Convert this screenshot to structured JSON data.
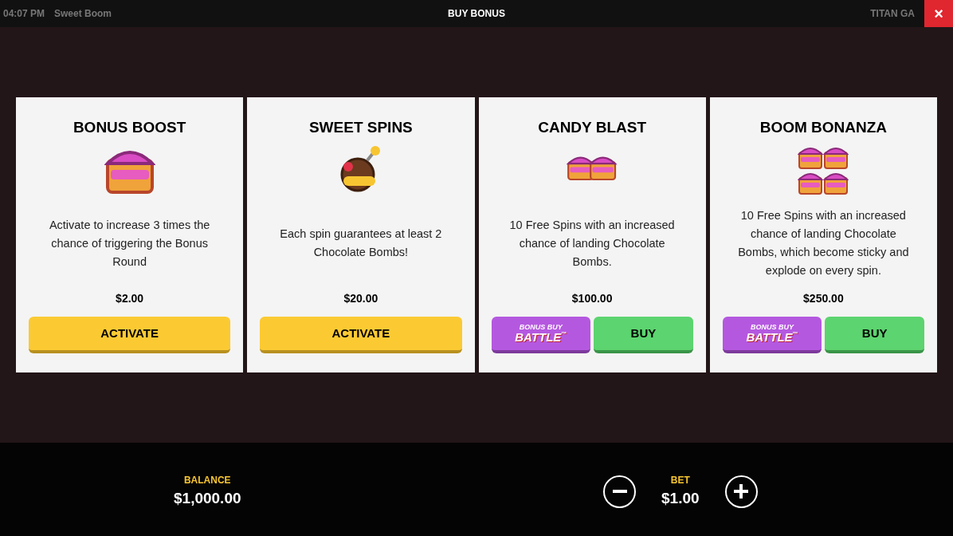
{
  "top_bar": {
    "time": "04:07 PM",
    "game": "Sweet Boom",
    "title": "BUY BONUS",
    "provider": "TITAN GA",
    "close": "×"
  },
  "cards": [
    {
      "title": "BONUS BOOST",
      "kind": "chest",
      "description": "Activate to increase 3 times the chance of triggering the Bonus Round",
      "price": "$2.00",
      "buttons": [
        {
          "kind": "activate",
          "label": "ACTIVATE"
        }
      ]
    },
    {
      "title": "SWEET SPINS",
      "kind": "bomb",
      "description": "Each spin guarantees at least 2 Chocolate Bombs!",
      "price": "$20.00",
      "buttons": [
        {
          "kind": "activate",
          "label": "ACTIVATE"
        }
      ]
    },
    {
      "title": "CANDY BLAST",
      "kind": "two_chests",
      "description": "10 Free Spins with an increased chance of landing Chocolate Bombs.",
      "price": "$100.00",
      "buttons": [
        {
          "kind": "battle",
          "label": "BONUS BUY",
          "label2": "BATTLE",
          "mark": "™"
        },
        {
          "kind": "buy",
          "label": "BUY"
        }
      ]
    },
    {
      "title": "BOOM BONANZA",
      "kind": "four_chests",
      "description": "10 Free Spins with an increased chance of landing Chocolate Bombs, which become sticky and explode on every spin.",
      "price": "$250.00",
      "buttons": [
        {
          "kind": "battle",
          "label": "BONUS BUY",
          "label2": "BATTLE",
          "mark": "™"
        },
        {
          "kind": "buy",
          "label": "BUY"
        }
      ]
    }
  ],
  "bottom_bar": {
    "balance_label": "BALANCE",
    "balance": "$1,000.00",
    "bet_label": "BET",
    "bet": "$1.00"
  }
}
